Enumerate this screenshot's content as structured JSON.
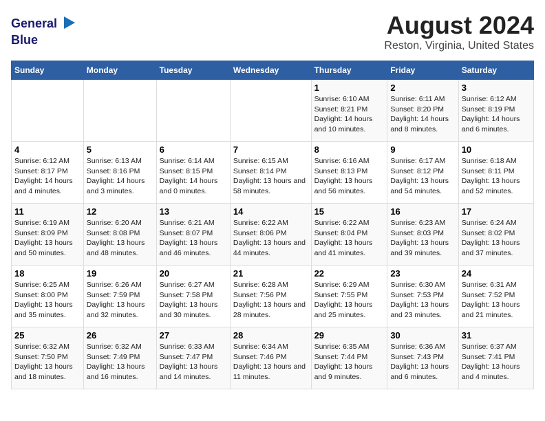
{
  "header": {
    "logo_line1": "General",
    "logo_line2": "Blue",
    "title": "August 2024",
    "subtitle": "Reston, Virginia, United States"
  },
  "weekdays": [
    "Sunday",
    "Monday",
    "Tuesday",
    "Wednesday",
    "Thursday",
    "Friday",
    "Saturday"
  ],
  "weeks": [
    [
      {
        "day": "",
        "sunrise": "",
        "sunset": "",
        "daylight": ""
      },
      {
        "day": "",
        "sunrise": "",
        "sunset": "",
        "daylight": ""
      },
      {
        "day": "",
        "sunrise": "",
        "sunset": "",
        "daylight": ""
      },
      {
        "day": "",
        "sunrise": "",
        "sunset": "",
        "daylight": ""
      },
      {
        "day": "1",
        "sunrise": "6:10 AM",
        "sunset": "8:21 PM",
        "daylight": "14 hours and 10 minutes."
      },
      {
        "day": "2",
        "sunrise": "6:11 AM",
        "sunset": "8:20 PM",
        "daylight": "14 hours and 8 minutes."
      },
      {
        "day": "3",
        "sunrise": "6:12 AM",
        "sunset": "8:19 PM",
        "daylight": "14 hours and 6 minutes."
      }
    ],
    [
      {
        "day": "4",
        "sunrise": "6:12 AM",
        "sunset": "8:17 PM",
        "daylight": "14 hours and 4 minutes."
      },
      {
        "day": "5",
        "sunrise": "6:13 AM",
        "sunset": "8:16 PM",
        "daylight": "14 hours and 3 minutes."
      },
      {
        "day": "6",
        "sunrise": "6:14 AM",
        "sunset": "8:15 PM",
        "daylight": "14 hours and 0 minutes."
      },
      {
        "day": "7",
        "sunrise": "6:15 AM",
        "sunset": "8:14 PM",
        "daylight": "13 hours and 58 minutes."
      },
      {
        "day": "8",
        "sunrise": "6:16 AM",
        "sunset": "8:13 PM",
        "daylight": "13 hours and 56 minutes."
      },
      {
        "day": "9",
        "sunrise": "6:17 AM",
        "sunset": "8:12 PM",
        "daylight": "13 hours and 54 minutes."
      },
      {
        "day": "10",
        "sunrise": "6:18 AM",
        "sunset": "8:11 PM",
        "daylight": "13 hours and 52 minutes."
      }
    ],
    [
      {
        "day": "11",
        "sunrise": "6:19 AM",
        "sunset": "8:09 PM",
        "daylight": "13 hours and 50 minutes."
      },
      {
        "day": "12",
        "sunrise": "6:20 AM",
        "sunset": "8:08 PM",
        "daylight": "13 hours and 48 minutes."
      },
      {
        "day": "13",
        "sunrise": "6:21 AM",
        "sunset": "8:07 PM",
        "daylight": "13 hours and 46 minutes."
      },
      {
        "day": "14",
        "sunrise": "6:22 AM",
        "sunset": "8:06 PM",
        "daylight": "13 hours and 44 minutes."
      },
      {
        "day": "15",
        "sunrise": "6:22 AM",
        "sunset": "8:04 PM",
        "daylight": "13 hours and 41 minutes."
      },
      {
        "day": "16",
        "sunrise": "6:23 AM",
        "sunset": "8:03 PM",
        "daylight": "13 hours and 39 minutes."
      },
      {
        "day": "17",
        "sunrise": "6:24 AM",
        "sunset": "8:02 PM",
        "daylight": "13 hours and 37 minutes."
      }
    ],
    [
      {
        "day": "18",
        "sunrise": "6:25 AM",
        "sunset": "8:00 PM",
        "daylight": "13 hours and 35 minutes."
      },
      {
        "day": "19",
        "sunrise": "6:26 AM",
        "sunset": "7:59 PM",
        "daylight": "13 hours and 32 minutes."
      },
      {
        "day": "20",
        "sunrise": "6:27 AM",
        "sunset": "7:58 PM",
        "daylight": "13 hours and 30 minutes."
      },
      {
        "day": "21",
        "sunrise": "6:28 AM",
        "sunset": "7:56 PM",
        "daylight": "13 hours and 28 minutes."
      },
      {
        "day": "22",
        "sunrise": "6:29 AM",
        "sunset": "7:55 PM",
        "daylight": "13 hours and 25 minutes."
      },
      {
        "day": "23",
        "sunrise": "6:30 AM",
        "sunset": "7:53 PM",
        "daylight": "13 hours and 23 minutes."
      },
      {
        "day": "24",
        "sunrise": "6:31 AM",
        "sunset": "7:52 PM",
        "daylight": "13 hours and 21 minutes."
      }
    ],
    [
      {
        "day": "25",
        "sunrise": "6:32 AM",
        "sunset": "7:50 PM",
        "daylight": "13 hours and 18 minutes."
      },
      {
        "day": "26",
        "sunrise": "6:32 AM",
        "sunset": "7:49 PM",
        "daylight": "13 hours and 16 minutes."
      },
      {
        "day": "27",
        "sunrise": "6:33 AM",
        "sunset": "7:47 PM",
        "daylight": "13 hours and 14 minutes."
      },
      {
        "day": "28",
        "sunrise": "6:34 AM",
        "sunset": "7:46 PM",
        "daylight": "13 hours and 11 minutes."
      },
      {
        "day": "29",
        "sunrise": "6:35 AM",
        "sunset": "7:44 PM",
        "daylight": "13 hours and 9 minutes."
      },
      {
        "day": "30",
        "sunrise": "6:36 AM",
        "sunset": "7:43 PM",
        "daylight": "13 hours and 6 minutes."
      },
      {
        "day": "31",
        "sunrise": "6:37 AM",
        "sunset": "7:41 PM",
        "daylight": "13 hours and 4 minutes."
      }
    ]
  ]
}
